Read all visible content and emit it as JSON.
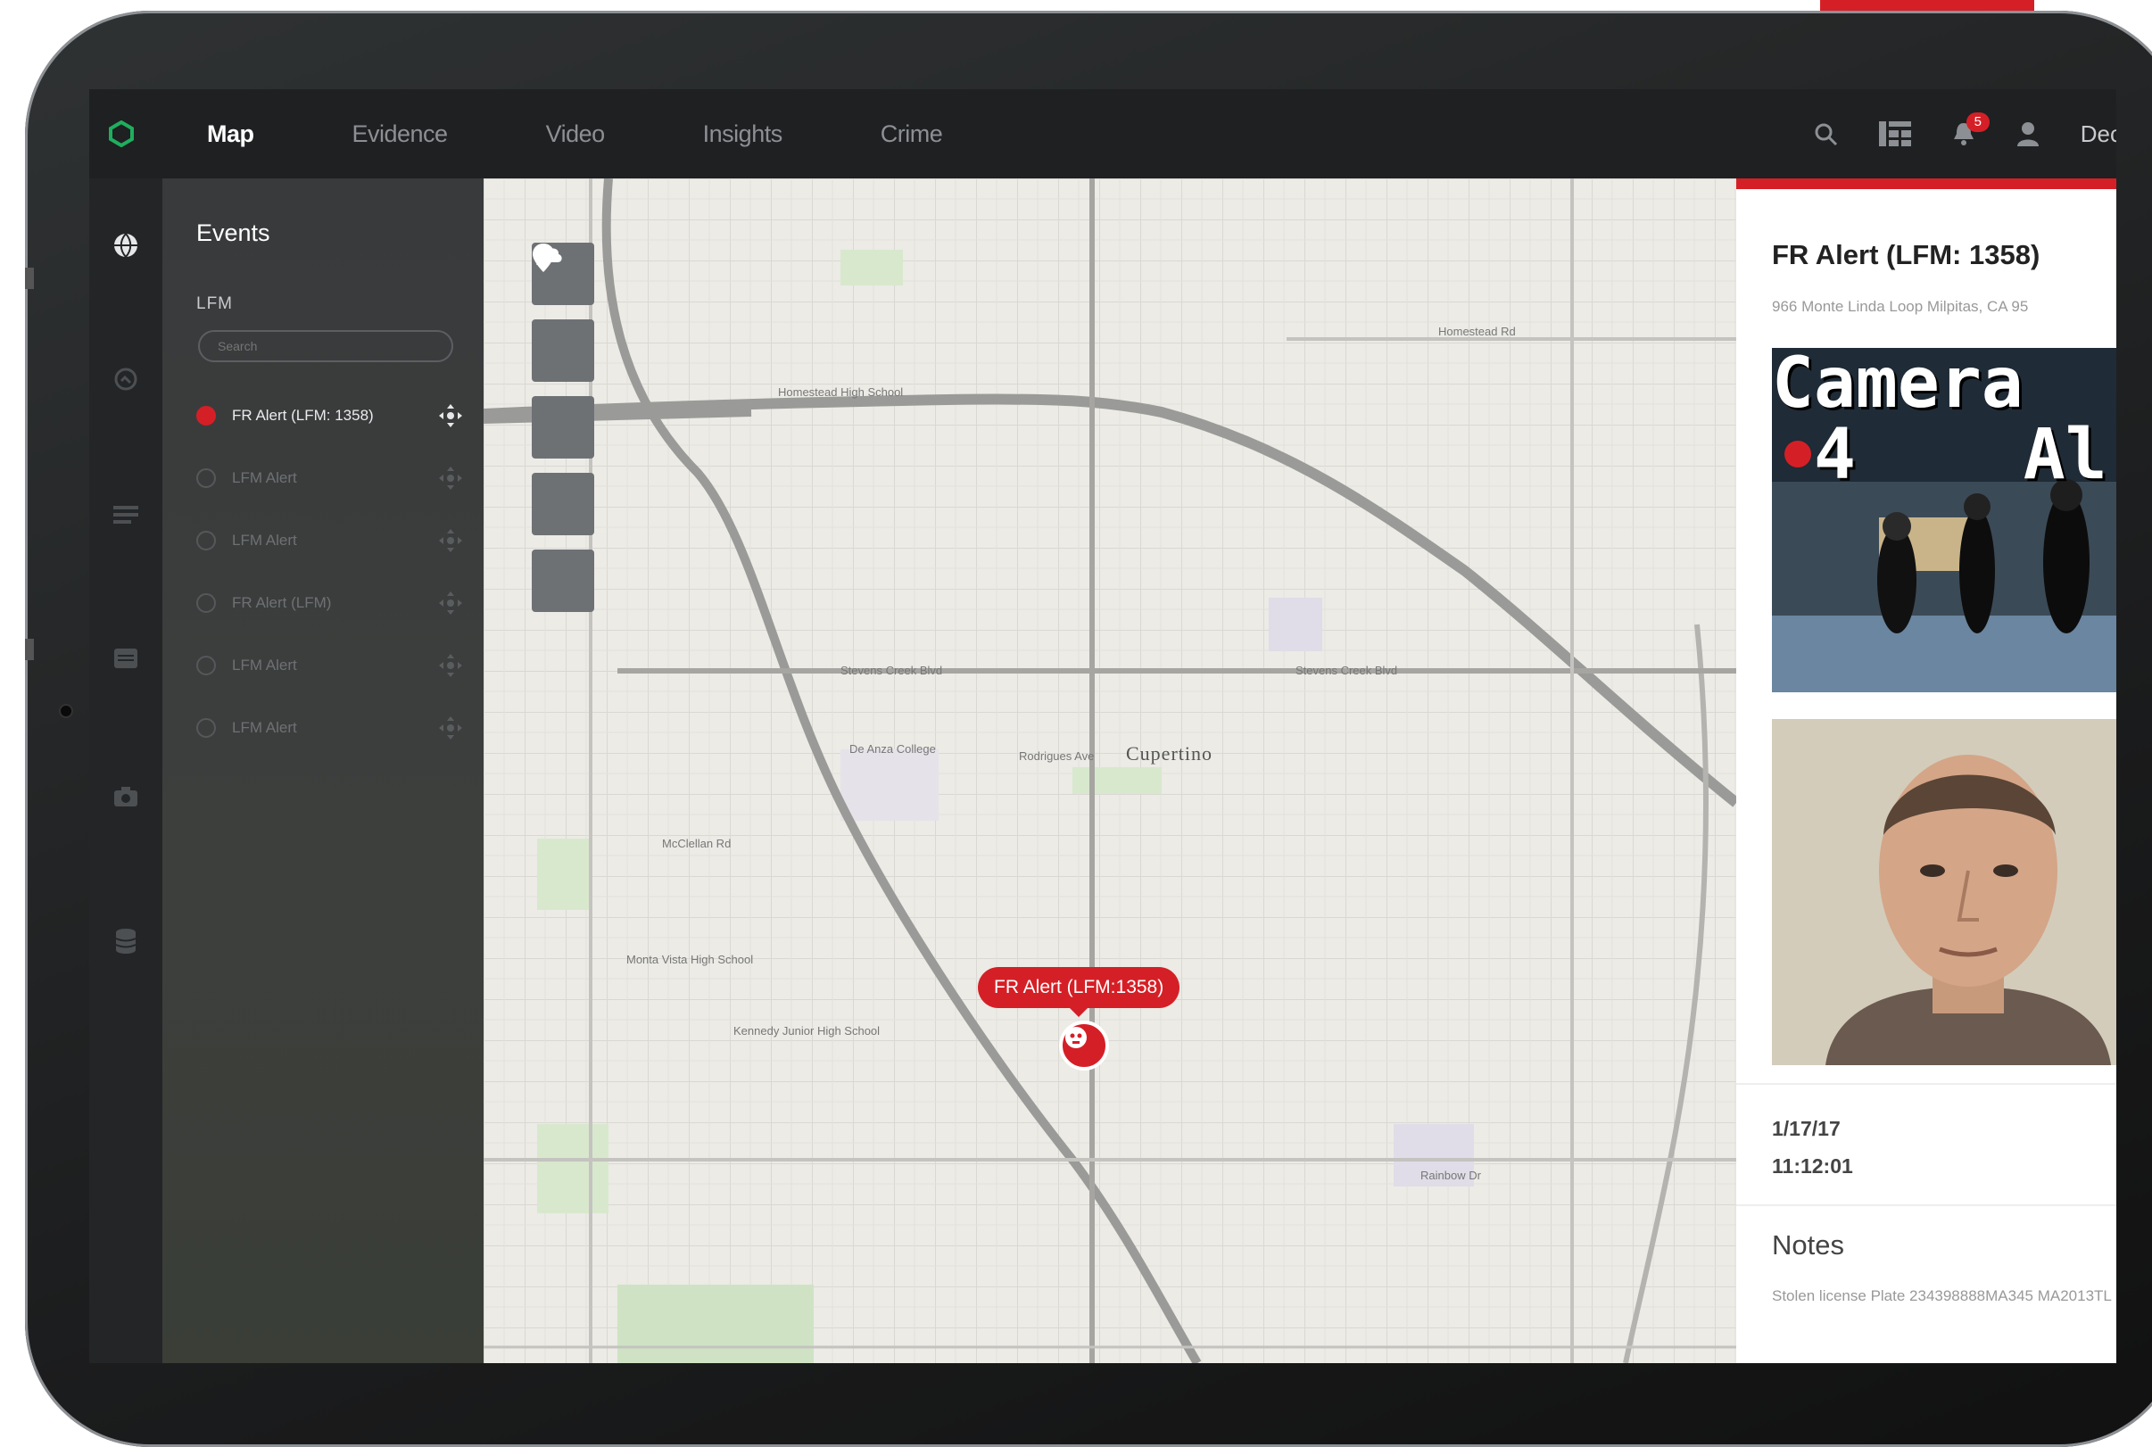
{
  "nav": {
    "items": [
      "Map",
      "Evidence",
      "Video",
      "Insights",
      "Crime"
    ],
    "active": "Map",
    "notification_count": "5",
    "user_name": "Dec"
  },
  "events": {
    "title": "Events",
    "section_label": "LFM",
    "search_placeholder": "Search",
    "items": [
      {
        "label": "FR Alert (LFM: 1358)",
        "selected": true
      },
      {
        "label": "LFM Alert",
        "selected": false
      },
      {
        "label": "LFM Alert",
        "selected": false
      },
      {
        "label": "FR Alert (LFM)",
        "selected": false
      },
      {
        "label": "LFM Alert",
        "selected": false
      },
      {
        "label": "LFM Alert",
        "selected": false
      }
    ]
  },
  "map": {
    "city": "Cupertino",
    "marker_label": "FR Alert (LFM:1358)",
    "labels": [
      "Homestead Rd",
      "Stevens Creek Blvd",
      "De Anza College",
      "Kennedy Junior High School",
      "Monta Vista High School",
      "McClellan Rd",
      "Rainbow Dr",
      "Homestead High School",
      "Rodrigues Ave"
    ]
  },
  "detail": {
    "title": "FR Alert (LFM: 1358)",
    "address": "966 Monte Linda Loop Milpitas, CA 95",
    "camera_overlay": "Camera\n 4    Al",
    "date": "1/17/17",
    "time": "11:12:01",
    "notes_heading": "Notes",
    "notes_text": "Stolen license Plate 234398888MA345 MA2013TL"
  },
  "colors": {
    "accent": "#d51f26",
    "nav_bg": "#1e2022",
    "panel_bg": "#383a3c"
  }
}
